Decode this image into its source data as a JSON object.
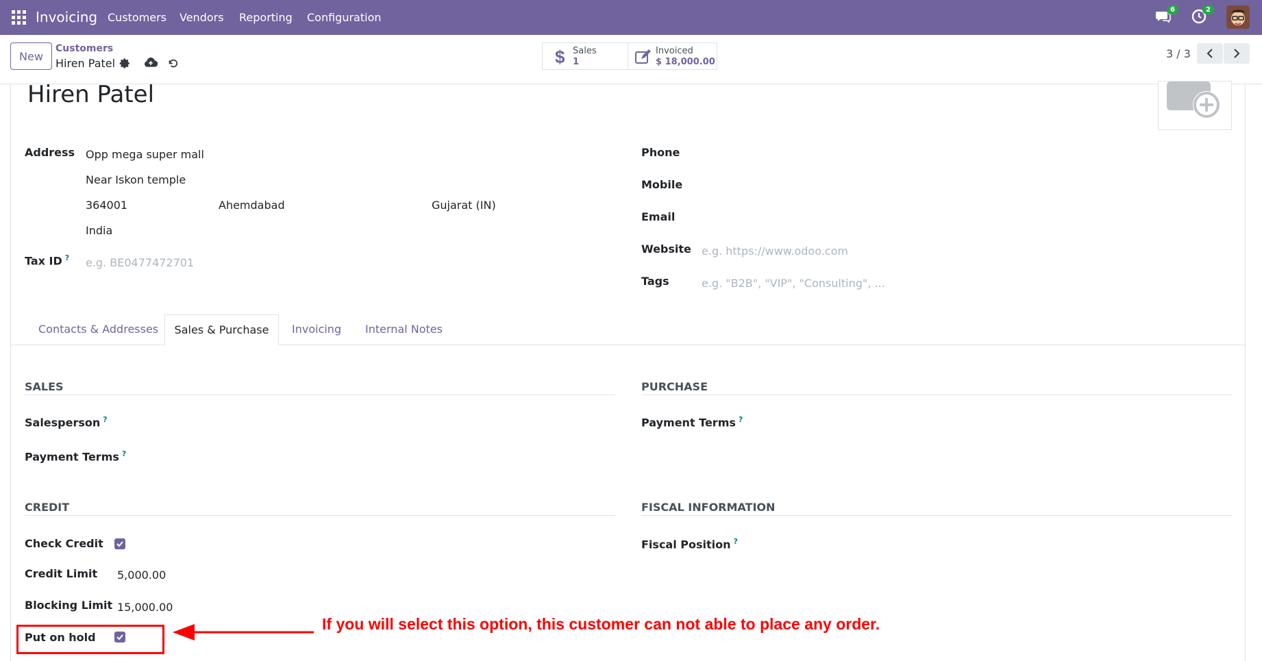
{
  "navbar": {
    "app_name": "Invoicing",
    "menu": [
      "Customers",
      "Vendors",
      "Reporting",
      "Configuration"
    ],
    "messages_count": "6",
    "activities_count": "2"
  },
  "control_panel": {
    "new_label": "New",
    "breadcrumb_parent": "Customers",
    "breadcrumb_current": "Hiren Patel",
    "stat_sales_label": "Sales",
    "stat_sales_value": "1",
    "stat_invoiced_label": "Invoiced",
    "stat_invoiced_value": "$ 18,000.00",
    "pager": "3 / 3"
  },
  "partner": {
    "name": "Hiren Patel",
    "address_label": "Address",
    "street": "Opp mega super mall",
    "street2": "Near Iskon temple",
    "zip": "364001",
    "city": "Ahemdabad",
    "state": "Gujarat (IN)",
    "country": "India",
    "tax_id_label": "Tax ID",
    "tax_id_placeholder": "e.g. BE0477472701",
    "phone_label": "Phone",
    "mobile_label": "Mobile",
    "email_label": "Email",
    "website_label": "Website",
    "website_placeholder": "e.g. https://www.odoo.com",
    "tags_label": "Tags",
    "tags_placeholder": "e.g. \"B2B\", \"VIP\", \"Consulting\", ..."
  },
  "tabs": [
    "Contacts & Addresses",
    "Sales & Purchase",
    "Invoicing",
    "Internal Notes"
  ],
  "sales": {
    "title": "SALES",
    "salesperson_label": "Salesperson",
    "payment_terms_label": "Payment Terms"
  },
  "purchase": {
    "title": "PURCHASE",
    "payment_terms_label": "Payment Terms"
  },
  "credit": {
    "title": "CREDIT",
    "check_credit_label": "Check Credit",
    "check_credit": true,
    "credit_limit_label": "Credit Limit",
    "credit_limit": "5,000.00",
    "blocking_limit_label": "Blocking Limit",
    "blocking_limit": "15,000.00",
    "put_on_hold_label": "Put on hold",
    "put_on_hold": true
  },
  "fiscal": {
    "title": "FISCAL INFORMATION",
    "fiscal_position_label": "Fiscal Position"
  },
  "annotation": {
    "text": "If you will select this option, this customer can not able to place any order.",
    "color": "#ff0000"
  },
  "colors": {
    "brand": "#71639e",
    "badge": "#28a745"
  }
}
